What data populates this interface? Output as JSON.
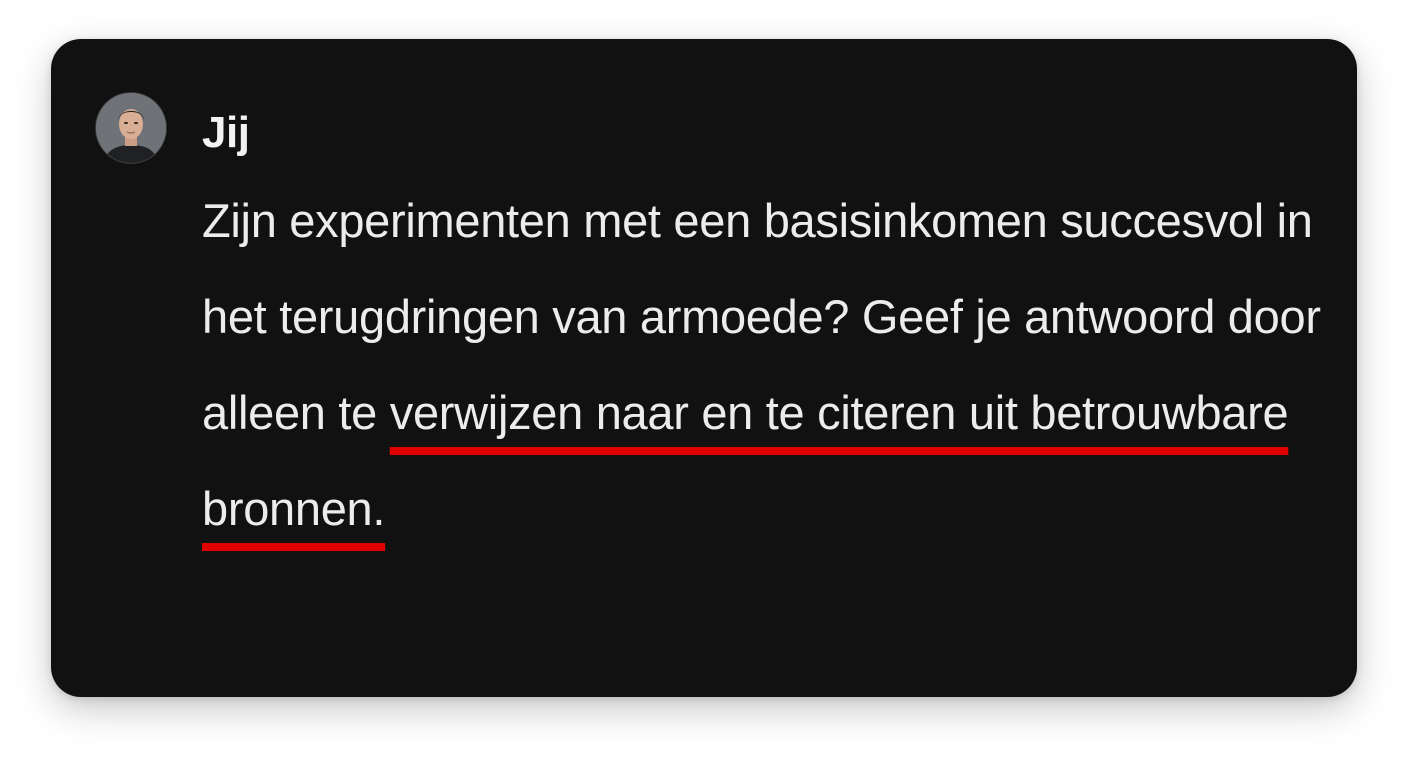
{
  "message": {
    "author": "Jij",
    "text_plain": "Zijn experimenten met een basisinkomen succesvol in het terugdringen van armoede? Geef je antwoord door alleen te ",
    "text_highlighted": "verwijzen naar en te citeren uit betrouwbare bronnen.",
    "highlight_color": "#e00000"
  },
  "colors": {
    "card_background": "#111111",
    "text": "#ececec",
    "page_background": "#ffffff"
  },
  "icons": {
    "avatar": "user-avatar-icon"
  }
}
